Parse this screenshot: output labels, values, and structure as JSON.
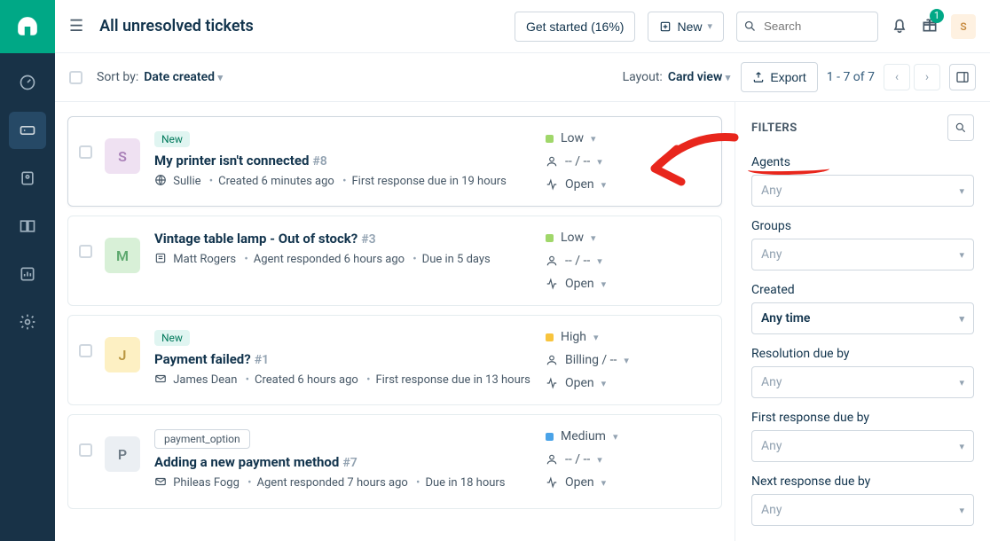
{
  "header": {
    "page_title": "All unresolved tickets",
    "get_started": "Get started (16%)",
    "new_button": "New",
    "search_placeholder": "Search",
    "gift_badge": "1",
    "avatar_initial": "S"
  },
  "toolbar": {
    "sort_label": "Sort by:",
    "sort_value": "Date created",
    "layout_label": "Layout:",
    "layout_value": "Card view",
    "export_label": "Export",
    "pagination_text": "1 - 7 of 7"
  },
  "tickets": [
    {
      "tag_type": "new",
      "tag_text": "New",
      "title": "My printer isn't connected",
      "id": "#8",
      "avatar_initial": "S",
      "avatar_bg": "#efe1f2",
      "avatar_fg": "#a980b8",
      "requester": "Sullie",
      "meta_line": "Created 6 minutes ago",
      "due_line": "First response due in 19 hours",
      "source_icon": "globe",
      "priority": "Low",
      "priority_color": "#a0d76a",
      "group_agent": "-- / --",
      "status": "Open"
    },
    {
      "tag_type": "",
      "tag_text": "",
      "title": "Vintage table lamp - Out of stock?",
      "id": "#3",
      "avatar_initial": "M",
      "avatar_bg": "#d8f0d7",
      "avatar_fg": "#5da86e",
      "requester": "Matt Rogers",
      "meta_line": "Agent responded 6 hours ago",
      "due_line": "Due in 5 days",
      "source_icon": "form",
      "priority": "Low",
      "priority_color": "#a0d76a",
      "group_agent": "-- / --",
      "status": "Open"
    },
    {
      "tag_type": "new",
      "tag_text": "New",
      "title": "Payment failed?",
      "id": "#1",
      "avatar_initial": "J",
      "avatar_bg": "#fdf0c3",
      "avatar_fg": "#b99642",
      "requester": "James Dean",
      "meta_line": "Created 6 hours ago",
      "due_line": "First response due in 13 hours",
      "source_icon": "email",
      "priority": "High",
      "priority_color": "#f8c43d",
      "group_agent": "Billing / --",
      "status": "Open"
    },
    {
      "tag_type": "pay",
      "tag_text": "payment_option",
      "title": "Adding a new payment method",
      "id": "#7",
      "avatar_initial": "P",
      "avatar_bg": "#ebeff3",
      "avatar_fg": "#6f7c87",
      "requester": "Phileas Fogg",
      "meta_line": "Agent responded 7 hours ago",
      "due_line": "Due in 18 hours",
      "source_icon": "email",
      "priority": "Medium",
      "priority_color": "#4aa3e8",
      "group_agent": "-- / --",
      "status": "Open"
    }
  ],
  "filters": {
    "title": "FILTERS",
    "fields": [
      {
        "label": "Agents",
        "value": "Any",
        "filled": false,
        "scribble": true
      },
      {
        "label": "Groups",
        "value": "Any",
        "filled": false,
        "scribble": false
      },
      {
        "label": "Created",
        "value": "Any time",
        "filled": true,
        "scribble": false
      },
      {
        "label": "Resolution due by",
        "value": "Any",
        "filled": false,
        "scribble": false
      },
      {
        "label": "First response due by",
        "value": "Any",
        "filled": false,
        "scribble": false
      },
      {
        "label": "Next response due by",
        "value": "Any",
        "filled": false,
        "scribble": false
      }
    ]
  },
  "annotation": {
    "arrow_color": "#e8261c"
  }
}
